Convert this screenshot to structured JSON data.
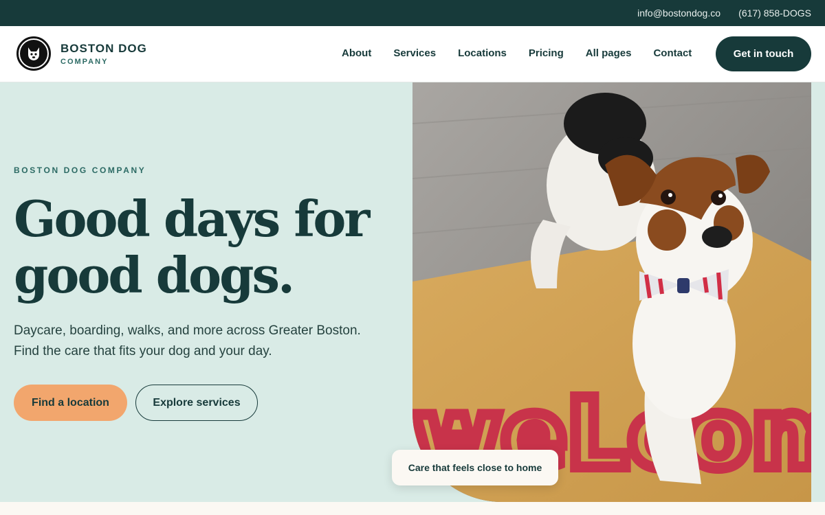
{
  "topbar": {
    "email": "info@bostondog.co",
    "phone": "(617) 858-DOGS"
  },
  "brand": {
    "name": "BOSTON DOG",
    "sub": "COMPANY",
    "logo_icon": "dog-logo-icon"
  },
  "nav": {
    "items": [
      {
        "label": "About"
      },
      {
        "label": "Services"
      },
      {
        "label": "Locations"
      },
      {
        "label": "Pricing"
      },
      {
        "label": "All pages"
      },
      {
        "label": "Contact"
      }
    ],
    "cta": "Get in touch"
  },
  "hero": {
    "eyebrow": "BOSTON DOG COMPANY",
    "headline_line1": "Good days for",
    "headline_line2": "good dogs.",
    "subtext_line1": "Daycare, boarding, walks, and more across Greater Boston.",
    "subtext_line2": "Find the care that fits your dog and your day.",
    "primary_button": "Find a location",
    "secondary_button": "Explore services",
    "caption": "Care that feels close to home",
    "mat_text": "weLcome"
  },
  "colors": {
    "dark_teal": "#173a3a",
    "hero_bg": "#d9ebe6",
    "accent_orange": "#f2a66d",
    "cream": "#fbf8f3"
  }
}
